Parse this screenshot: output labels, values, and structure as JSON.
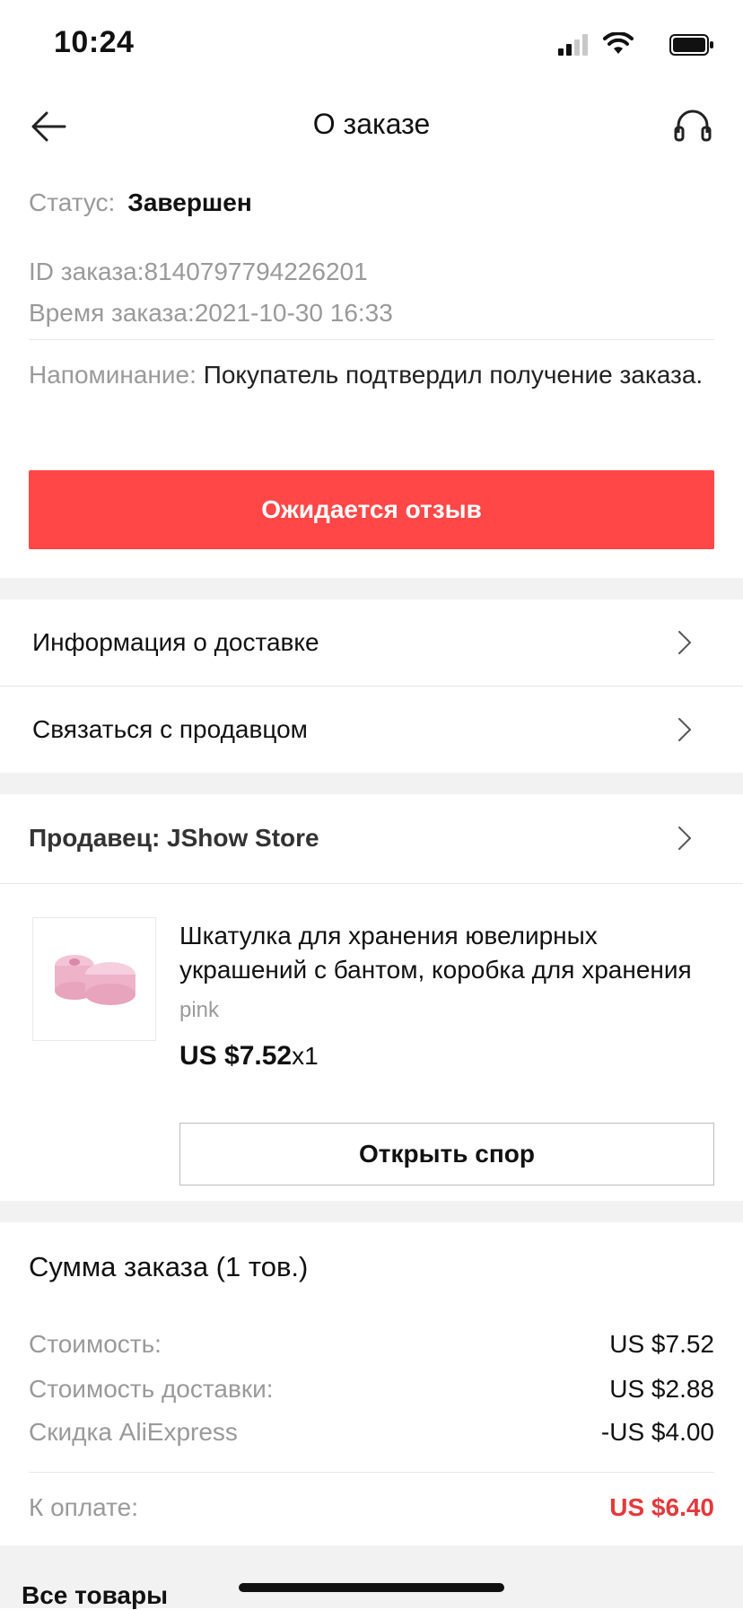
{
  "status_bar": {
    "time": "10:24"
  },
  "header": {
    "title": "О заказе"
  },
  "order": {
    "status_label": "Статус:",
    "status_value": "Завершен",
    "id_line": "ID заказа:8140797794226201",
    "time_line": "Время заказа:2021-10-30 16:33",
    "reminder_label": "Напоминание:",
    "reminder_text": "Покупатель подтвердил получение заказа."
  },
  "actions": {
    "review_button": "Ожидается отзыв"
  },
  "menu": {
    "delivery_info": "Информация о доставке",
    "contact_seller": "Связаться с продавцом"
  },
  "seller": {
    "label": "Продавец: JShow Store"
  },
  "product": {
    "title": "Шкатулка для хранения ювелирных украшений с бантом, коробка для хранения",
    "variant": "pink",
    "price": "US $7.52",
    "qty": "x1",
    "dispute_button": "Открыть спор"
  },
  "summary": {
    "title": "Сумма заказа (1 тов.)",
    "rows": [
      {
        "label": "Стоимость:",
        "value": "US $7.52"
      },
      {
        "label": "Стоимость доставки:",
        "value": "US $2.88"
      },
      {
        "label": "Скидка AliExpress",
        "value": "-US $4.00"
      }
    ],
    "total_label": "К оплате:",
    "total_value": "US $6.40"
  },
  "bottom": {
    "title": "Все товары"
  },
  "colors": {
    "accent": "#ff4747",
    "total": "#e4393c",
    "muted": "#9a9a9a",
    "gap": "#f2f2f2"
  },
  "icons": [
    "back-arrow-icon",
    "headset-icon",
    "chevron-right-icon",
    "signal-icon",
    "wifi-icon",
    "battery-icon"
  ]
}
